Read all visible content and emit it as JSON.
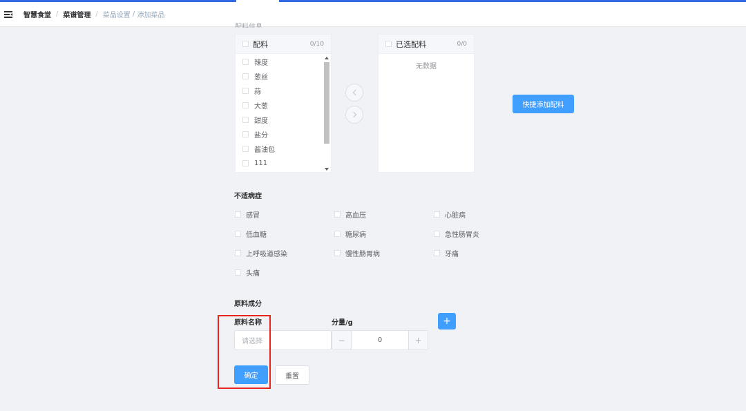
{
  "breadcrumb": [
    "智慧食堂",
    "菜谱管理",
    "菜品设置",
    "添加菜品"
  ],
  "breadcrumb_separator": "/",
  "cut_label": "配料信息",
  "transfer": {
    "left": {
      "title": "配料",
      "count": "0/10",
      "items": [
        "辣度",
        "葱丝",
        "蒜",
        "大葱",
        "甜度",
        "盐分",
        "酱油包",
        "111"
      ]
    },
    "right": {
      "title": "已选配料",
      "count": "0/0",
      "empty_text": "无数据"
    }
  },
  "quick_add_label": "快捷添加配料",
  "disease_section": {
    "title": "不适病症",
    "items": [
      "感冒",
      "高血压",
      "心脏病",
      "低血糖",
      "糖尿病",
      "急性肠胃炎",
      "上呼吸道感染",
      "慢性肠胃病",
      "牙痛",
      "头痛"
    ]
  },
  "ingredients_section": {
    "title": "原料成分",
    "name_label": "原料名称",
    "amount_label": "分量/g",
    "add_label": "+",
    "select_placeholder": "请选择",
    "stepper_value": "0",
    "minus": "−",
    "plus": "+"
  },
  "actions": {
    "confirm": "确定",
    "reset": "重置"
  },
  "colors": {
    "primary": "#409eff",
    "top_accent": "#2f6bde",
    "highlight": "#e6251f"
  }
}
